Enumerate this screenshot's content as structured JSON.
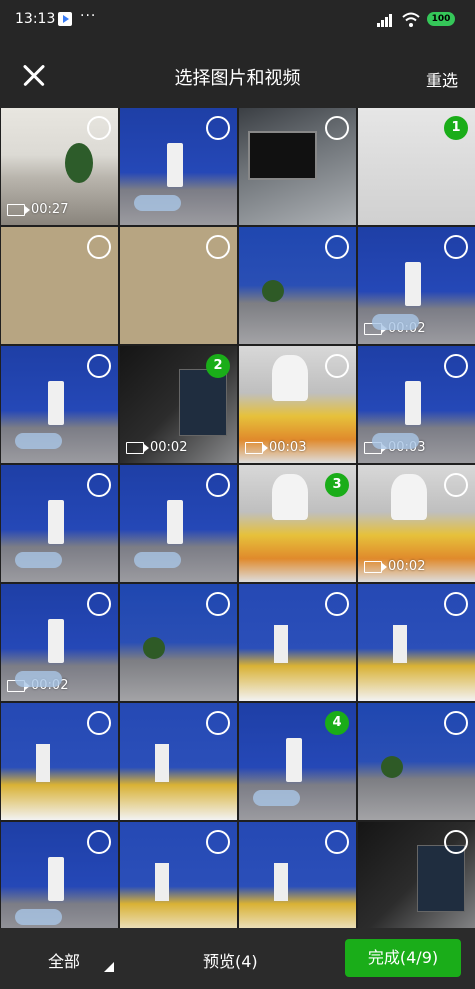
{
  "status_bar": {
    "time": "13:13",
    "dots": "···",
    "battery": "100",
    "battery_color": "#35c759"
  },
  "header": {
    "close_icon": "close-x-icon",
    "title": "选择图片和视频",
    "reselect_label": "重选"
  },
  "grid": [
    {
      "kind": "office",
      "video": "00:27",
      "selected": null
    },
    {
      "kind": "blue",
      "video": null,
      "selected": null
    },
    {
      "kind": "desk",
      "video": null,
      "selected": null
    },
    {
      "kind": "doc",
      "video": null,
      "selected": "1"
    },
    {
      "kind": "beige",
      "video": null,
      "selected": null
    },
    {
      "kind": "beige",
      "video": null,
      "selected": null
    },
    {
      "kind": "plant",
      "video": null,
      "selected": null
    },
    {
      "kind": "blue",
      "video": "00:02",
      "selected": null
    },
    {
      "kind": "blue",
      "video": null,
      "selected": null
    },
    {
      "kind": "screen",
      "video": "00:02",
      "selected": "2"
    },
    {
      "kind": "snack",
      "video": "00:03",
      "selected": null
    },
    {
      "kind": "blue",
      "video": "00:03",
      "selected": null
    },
    {
      "kind": "blue",
      "video": null,
      "selected": null
    },
    {
      "kind": "blue",
      "video": null,
      "selected": null
    },
    {
      "kind": "snack",
      "video": null,
      "selected": "3"
    },
    {
      "kind": "snack",
      "video": "00:02",
      "selected": null
    },
    {
      "kind": "blue",
      "video": "00:02",
      "selected": null
    },
    {
      "kind": "plant",
      "video": null,
      "selected": null
    },
    {
      "kind": "blue-snack",
      "video": null,
      "selected": null
    },
    {
      "kind": "blue-snack",
      "video": null,
      "selected": null
    },
    {
      "kind": "blue-snack",
      "video": null,
      "selected": null
    },
    {
      "kind": "blue-snack",
      "video": null,
      "selected": null
    },
    {
      "kind": "blue",
      "video": null,
      "selected": "4"
    },
    {
      "kind": "plant",
      "video": null,
      "selected": null
    },
    {
      "kind": "blue",
      "video": null,
      "selected": null
    },
    {
      "kind": "blue-snack",
      "video": null,
      "selected": null
    },
    {
      "kind": "blue-snack",
      "video": null,
      "selected": null
    },
    {
      "kind": "screen",
      "video": null,
      "selected": null
    }
  ],
  "bottom_bar": {
    "all_label": "全部",
    "preview_label": "预览(4)",
    "done_label": "完成(4/9)",
    "accent_color": "#1aad19"
  }
}
